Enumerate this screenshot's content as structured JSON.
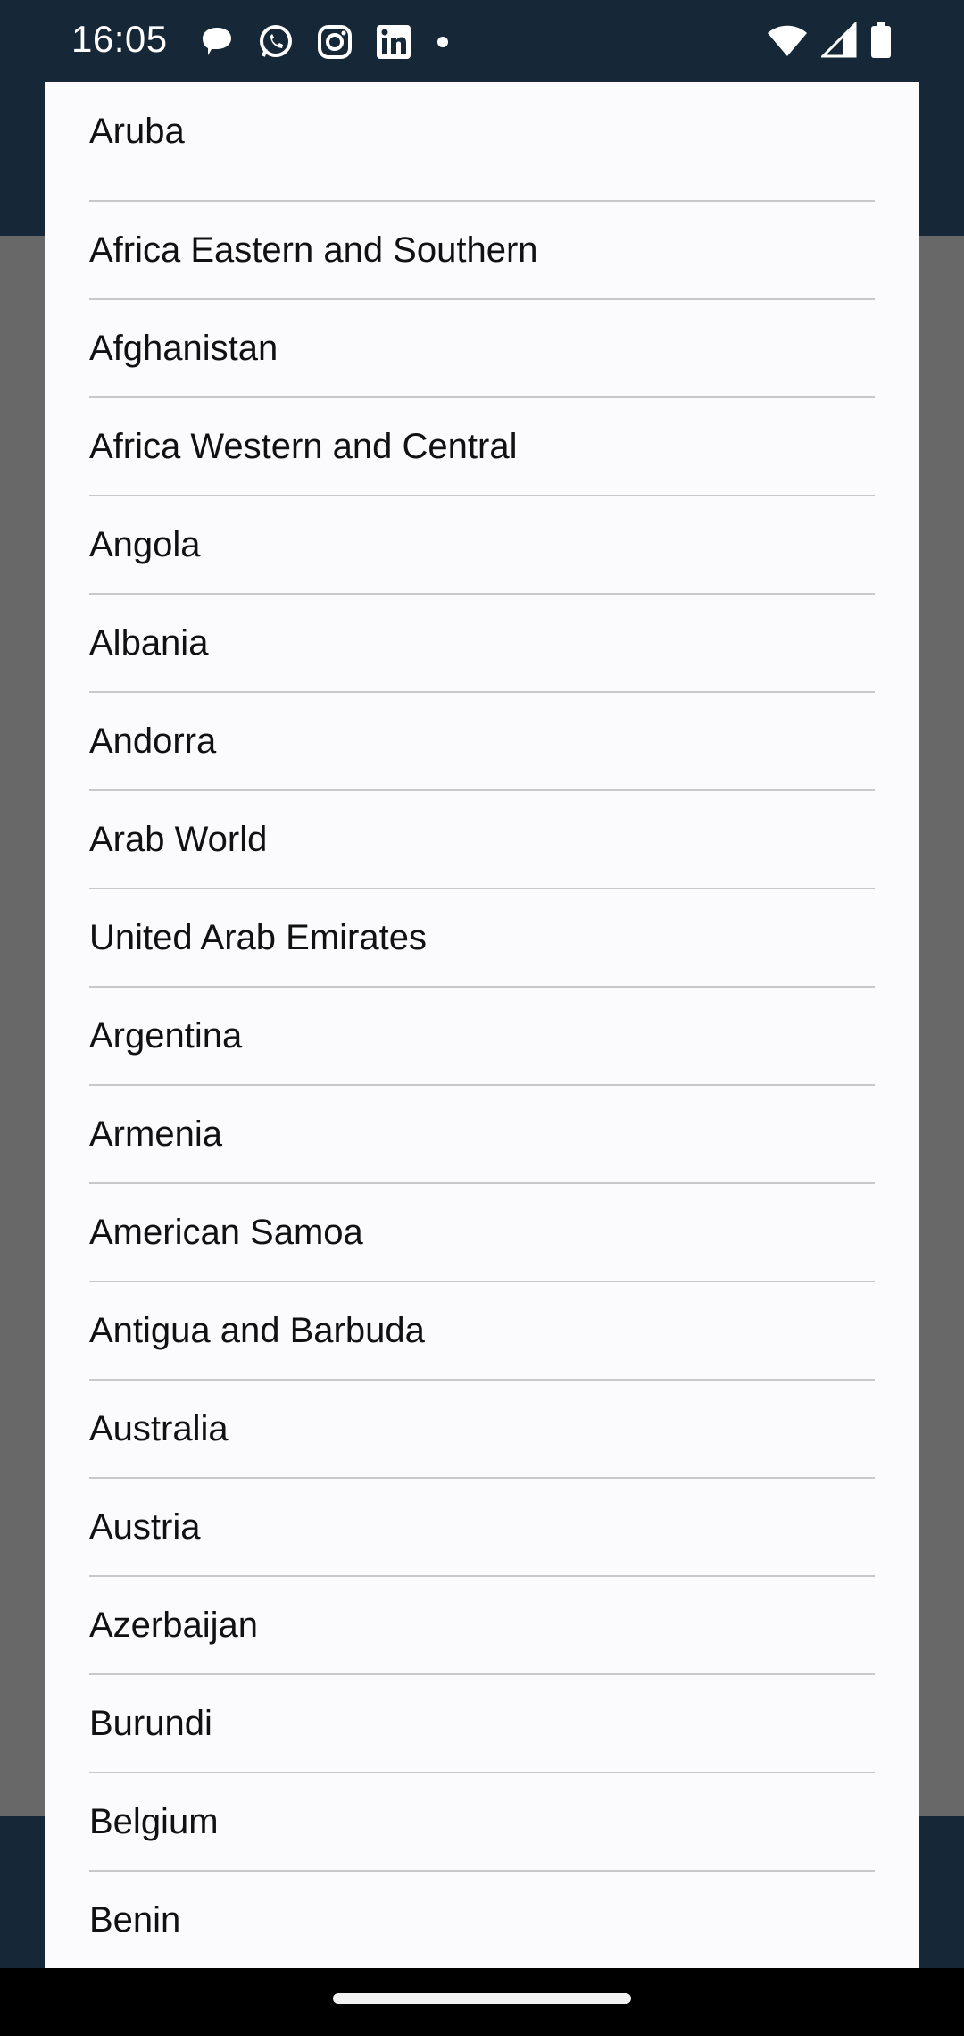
{
  "status_bar": {
    "time": "16:05",
    "notification_icons": [
      "chat-bubble-icon",
      "whatsapp-icon",
      "instagram-icon",
      "linkedin-icon"
    ],
    "system_icons": [
      "wifi-icon",
      "cellular-signal-icon",
      "battery-icon"
    ]
  },
  "dialog": {
    "countries": [
      "Aruba",
      "Africa Eastern and Southern",
      "Afghanistan",
      "Africa Western and Central",
      "Angola",
      "Albania",
      "Andorra",
      "Arab World",
      "United Arab Emirates",
      "Argentina",
      "Armenia",
      "American Samoa",
      "Antigua and Barbuda",
      "Australia",
      "Austria",
      "Azerbaijan",
      "Burundi",
      "Belgium",
      "Benin"
    ]
  },
  "colors": {
    "status_bar_bg": "#162838",
    "scrim": "#686868",
    "dialog_bg": "#fbfafd",
    "divider": "#c8c8c8",
    "text": "#111111"
  }
}
